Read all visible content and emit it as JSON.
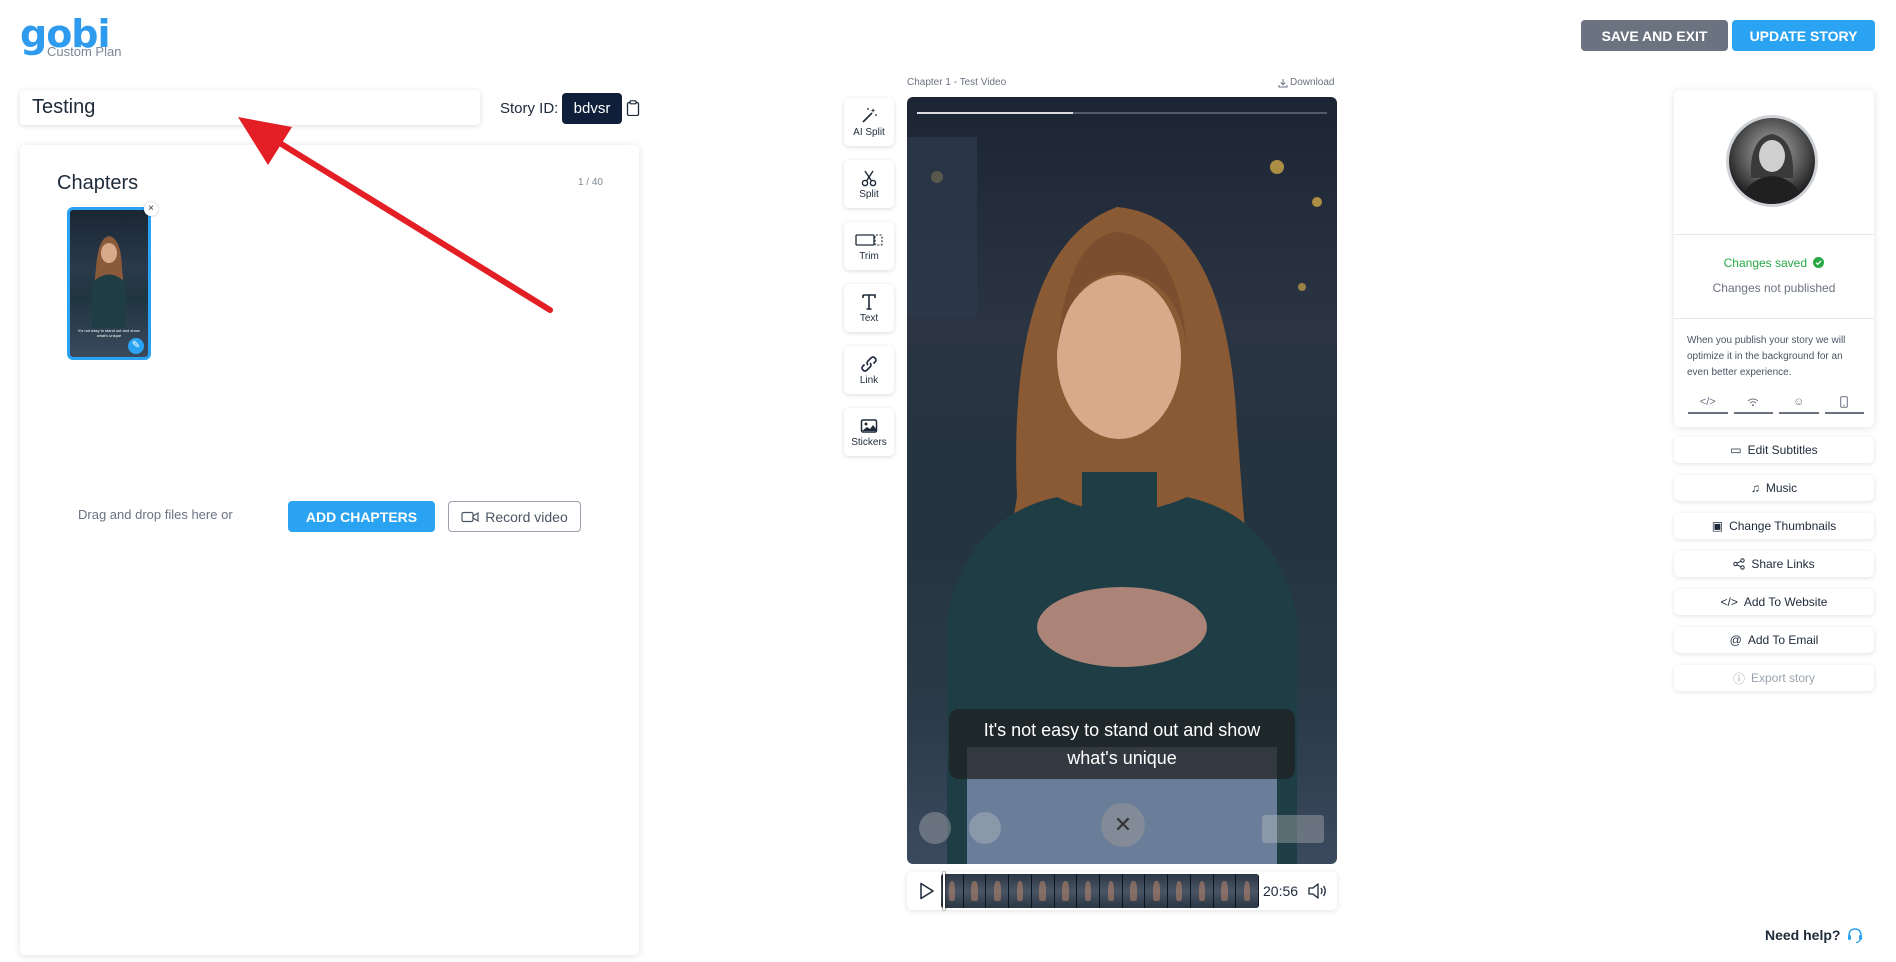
{
  "header": {
    "logo_text": "gobi",
    "plan_label": "Custom Plan",
    "save_exit_label": "SAVE AND EXIT",
    "update_story_label": "UPDATE STORY"
  },
  "story": {
    "title": "Testing",
    "id_label": "Story ID:",
    "id_value": "bdvsr"
  },
  "chapters": {
    "heading": "Chapters",
    "count": "1 / 40",
    "drag_text": "Drag and drop files here or",
    "add_label": "ADD CHAPTERS",
    "record_label": "Record video",
    "thumb_caption": "It's not easy to stand out and show what's unique"
  },
  "tools": [
    {
      "label": "AI Split",
      "icon": "magic-wand-icon"
    },
    {
      "label": "Split",
      "icon": "scissors-icon"
    },
    {
      "label": "Trim",
      "icon": "trim-icon"
    },
    {
      "label": "Text",
      "icon": "text-icon"
    },
    {
      "label": "Link",
      "icon": "link-icon"
    },
    {
      "label": "Stickers",
      "icon": "image-icon"
    }
  ],
  "video": {
    "title": "Chapter 1 - Test Video",
    "download_label": "Download",
    "subtitle": "It's not easy to stand out and show what's unique",
    "progress": 0.38,
    "time": "20:56"
  },
  "right_panel": {
    "changes_saved": "Changes saved",
    "changes_not_published": "Changes not published",
    "publish_info": "When you publish your story we will optimize it in the background for an even better experience.",
    "buttons": [
      {
        "label": "Edit Subtitles",
        "icon": "subtitles-icon"
      },
      {
        "label": "Music",
        "icon": "music-icon"
      },
      {
        "label": "Change Thumbnails",
        "icon": "image-icon"
      },
      {
        "label": "Share Links",
        "icon": "share-icon"
      },
      {
        "label": "Add To Website",
        "icon": "code-icon"
      },
      {
        "label": "Add To Email",
        "icon": "at-icon"
      },
      {
        "label": "Export story",
        "icon": "info-icon"
      }
    ]
  },
  "footer": {
    "need_help": "Need help?"
  },
  "colors": {
    "brand": "#2ba3f3",
    "save_exit_bg": "#6b7280",
    "story_id_bg": "#0f1f3a",
    "success": "#27a845",
    "annotation_arrow": "#e31e24"
  }
}
